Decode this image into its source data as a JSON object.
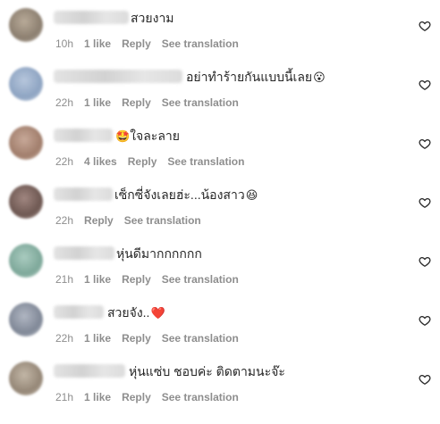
{
  "comments": [
    {
      "text": "สวยงาม",
      "emoji": "",
      "time": "10h",
      "likes": "1 like",
      "reply": "Reply",
      "translate": "See translation"
    },
    {
      "text": "อย่าทำร้ายกันแบบนี้เลย",
      "emoji": "😮",
      "time": "22h",
      "likes": "1 like",
      "reply": "Reply",
      "translate": "See translation"
    },
    {
      "text": "ใจละลาย",
      "emoji": "🤩",
      "time": "22h",
      "likes": "4 likes",
      "reply": "Reply",
      "translate": "See translation"
    },
    {
      "text": "เซ็กซี่จังเลยฮ่ะ...น้องสาว",
      "emoji": "😆",
      "time": "22h",
      "likes": "",
      "reply": "Reply",
      "translate": "See translation"
    },
    {
      "text": "หุ่นดีมากกกกกก",
      "emoji": "",
      "time": "21h",
      "likes": "1 like",
      "reply": "Reply",
      "translate": "See translation"
    },
    {
      "text": "สวยจัง..",
      "emoji": "❤️",
      "time": "22h",
      "likes": "1 like",
      "reply": "Reply",
      "translate": "See translation"
    },
    {
      "text": "หุ่นแซ่บ ชอบค่ะ ติดตามนะจ๊ะ",
      "emoji": "",
      "time": "21h",
      "likes": "1 like",
      "reply": "Reply",
      "translate": "See translation"
    }
  ],
  "icons": {
    "like": "heart-outline-icon",
    "avatar": "blurred-avatar"
  },
  "colors": {
    "text": "#262626",
    "meta": "#8e8e8e",
    "background": "#ffffff"
  }
}
